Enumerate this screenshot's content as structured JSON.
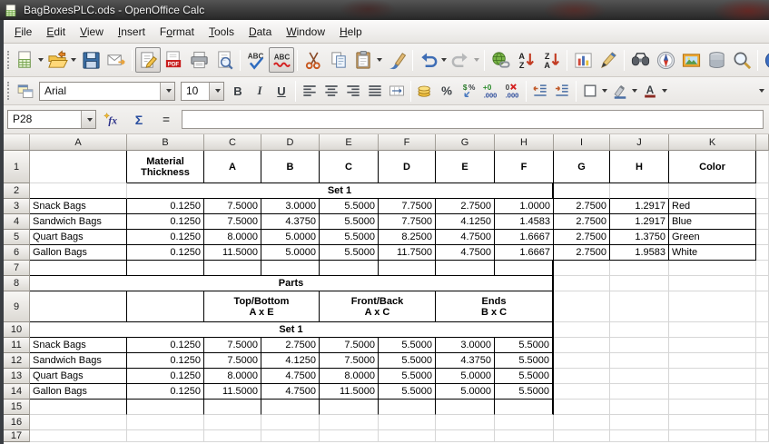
{
  "window": {
    "title": "BagBoxesPLC.ods - OpenOffice Calc",
    "app_icon": "calc-document-icon"
  },
  "menu_bar": {
    "items": [
      {
        "label": "File",
        "mnemonic_index": 0
      },
      {
        "label": "Edit",
        "mnemonic_index": 0
      },
      {
        "label": "View",
        "mnemonic_index": 0
      },
      {
        "label": "Insert",
        "mnemonic_index": 0
      },
      {
        "label": "Format",
        "mnemonic_index": 1
      },
      {
        "label": "Tools",
        "mnemonic_index": 0
      },
      {
        "label": "Data",
        "mnemonic_index": 0
      },
      {
        "label": "Window",
        "mnemonic_index": 0
      },
      {
        "label": "Help",
        "mnemonic_index": 0
      }
    ]
  },
  "standard_toolbar": {
    "buttons": [
      {
        "name": "new-document",
        "dropdown": true
      },
      {
        "name": "open",
        "dropdown": true
      },
      {
        "name": "save"
      },
      {
        "name": "email"
      },
      {
        "separator": true
      },
      {
        "name": "edit-file",
        "framed": true
      },
      {
        "name": "export-pdf"
      },
      {
        "name": "print"
      },
      {
        "name": "page-preview"
      },
      {
        "separator": true
      },
      {
        "name": "spelling"
      },
      {
        "name": "auto-spellcheck",
        "framed": true
      },
      {
        "separator": true
      },
      {
        "name": "cut"
      },
      {
        "name": "copy"
      },
      {
        "name": "paste",
        "dropdown": true
      },
      {
        "name": "format-paintbrush"
      },
      {
        "separator": true
      },
      {
        "name": "undo",
        "dropdown": true
      },
      {
        "name": "redo",
        "dropdown": true,
        "disabled": true
      },
      {
        "separator": true
      },
      {
        "name": "hyperlink"
      },
      {
        "name": "sort-ascending"
      },
      {
        "name": "sort-descending"
      },
      {
        "separator": true
      },
      {
        "name": "chart"
      },
      {
        "name": "draw-functions"
      },
      {
        "separator": true
      },
      {
        "name": "find-replace"
      },
      {
        "name": "navigator"
      },
      {
        "name": "gallery"
      },
      {
        "name": "data-sources"
      },
      {
        "name": "zoom"
      },
      {
        "separator": true
      },
      {
        "name": "help"
      }
    ]
  },
  "formatting_toolbar": {
    "font_name": "Arial",
    "font_size": "10",
    "buttons": [
      {
        "name": "styles"
      },
      {
        "combo": "font"
      },
      {
        "combo": "size"
      },
      {
        "name": "bold",
        "text": "B"
      },
      {
        "name": "italic",
        "text": "I"
      },
      {
        "name": "underline",
        "text": "U"
      },
      {
        "separator": true
      },
      {
        "name": "align-left"
      },
      {
        "name": "align-center"
      },
      {
        "name": "align-right"
      },
      {
        "name": "justify"
      },
      {
        "name": "merge-cells"
      },
      {
        "separator": true
      },
      {
        "name": "currency-format"
      },
      {
        "name": "percent-format"
      },
      {
        "name": "standard-format"
      },
      {
        "name": "add-decimal"
      },
      {
        "name": "delete-decimal"
      },
      {
        "separator": true
      },
      {
        "name": "decrease-indent"
      },
      {
        "name": "increase-indent"
      },
      {
        "separator": true
      },
      {
        "name": "borders",
        "dropdown": true
      },
      {
        "name": "background-color",
        "dropdown": true
      },
      {
        "name": "font-color",
        "dropdown": true
      }
    ]
  },
  "formula_bar": {
    "cell_reference": "P28",
    "input_value": ""
  },
  "sheet": {
    "column_headers": [
      "A",
      "B",
      "C",
      "D",
      "E",
      "F",
      "G",
      "H",
      "I",
      "J",
      "K"
    ],
    "row_count": 17,
    "rows": [
      {
        "n": 1,
        "cells": [
          {
            "col": "A",
            "text": "",
            "b": "r"
          },
          {
            "col": "B",
            "text": "Material\nThickness",
            "bold": true,
            "align": "c",
            "b": "rb"
          },
          {
            "col": "C",
            "text": "A",
            "bold": true,
            "align": "c",
            "b": "rb"
          },
          {
            "col": "D",
            "text": "B",
            "bold": true,
            "align": "c",
            "b": "rb"
          },
          {
            "col": "E",
            "text": "C",
            "bold": true,
            "align": "c",
            "b": "rb"
          },
          {
            "col": "F",
            "text": "D",
            "bold": true,
            "align": "c",
            "b": "rb"
          },
          {
            "col": "G",
            "text": "E",
            "bold": true,
            "align": "c",
            "b": "rb"
          },
          {
            "col": "H",
            "text": "F",
            "bold": true,
            "align": "c",
            "b": "rb"
          },
          {
            "col": "I",
            "text": "G",
            "bold": true,
            "align": "c",
            "b": "rb"
          },
          {
            "col": "J",
            "text": "H",
            "bold": true,
            "align": "c",
            "b": "rb"
          },
          {
            "col": "K",
            "text": "Color",
            "bold": true,
            "align": "c",
            "b": "rb"
          }
        ]
      },
      {
        "n": 2,
        "cells": [
          {
            "col": "A",
            "text": "",
            "b": "b"
          },
          {
            "col": "B",
            "span": 7,
            "text": "Set 1",
            "bold": true,
            "align": "c",
            "b": "Rb"
          },
          {
            "col": "I",
            "text": "",
            "b": "b"
          },
          {
            "col": "J",
            "text": "",
            "b": "b"
          },
          {
            "col": "K",
            "text": "",
            "b": "b"
          }
        ]
      },
      {
        "n": 3,
        "cells": [
          {
            "col": "A",
            "text": "Snack Bags",
            "b": "rb"
          },
          {
            "col": "B",
            "text": "0.1250",
            "align": "r",
            "b": "rb"
          },
          {
            "col": "C",
            "text": "7.5000",
            "align": "r",
            "b": "rb"
          },
          {
            "col": "D",
            "text": "3.0000",
            "align": "r",
            "b": "rb"
          },
          {
            "col": "E",
            "text": "5.5000",
            "align": "r",
            "b": "rb"
          },
          {
            "col": "F",
            "text": "7.7500",
            "align": "r",
            "b": "rb"
          },
          {
            "col": "G",
            "text": "2.7500",
            "align": "r",
            "b": "rb"
          },
          {
            "col": "H",
            "text": "1.0000",
            "align": "r",
            "b": "rb"
          },
          {
            "col": "I",
            "text": "2.7500",
            "align": "r",
            "b": "rb"
          },
          {
            "col": "J",
            "text": "1.2917",
            "align": "r",
            "b": "rb"
          },
          {
            "col": "K",
            "text": "Red",
            "b": "rb"
          }
        ]
      },
      {
        "n": 4,
        "cells": [
          {
            "col": "A",
            "text": "Sandwich Bags",
            "b": "rb"
          },
          {
            "col": "B",
            "text": "0.1250",
            "align": "r",
            "b": "rb"
          },
          {
            "col": "C",
            "text": "7.5000",
            "align": "r",
            "b": "rb"
          },
          {
            "col": "D",
            "text": "4.3750",
            "align": "r",
            "b": "rb"
          },
          {
            "col": "E",
            "text": "5.5000",
            "align": "r",
            "b": "rb"
          },
          {
            "col": "F",
            "text": "7.7500",
            "align": "r",
            "b": "rb"
          },
          {
            "col": "G",
            "text": "4.1250",
            "align": "r",
            "b": "rb"
          },
          {
            "col": "H",
            "text": "1.4583",
            "align": "r",
            "b": "rb"
          },
          {
            "col": "I",
            "text": "2.7500",
            "align": "r",
            "b": "rb"
          },
          {
            "col": "J",
            "text": "1.2917",
            "align": "r",
            "b": "rb"
          },
          {
            "col": "K",
            "text": "Blue",
            "b": "rb"
          }
        ]
      },
      {
        "n": 5,
        "cells": [
          {
            "col": "A",
            "text": "Quart Bags",
            "b": "rb"
          },
          {
            "col": "B",
            "text": "0.1250",
            "align": "r",
            "b": "rb"
          },
          {
            "col": "C",
            "text": "8.0000",
            "align": "r",
            "b": "rb"
          },
          {
            "col": "D",
            "text": "5.0000",
            "align": "r",
            "b": "rb"
          },
          {
            "col": "E",
            "text": "5.5000",
            "align": "r",
            "b": "rb"
          },
          {
            "col": "F",
            "text": "8.2500",
            "align": "r",
            "b": "rb"
          },
          {
            "col": "G",
            "text": "4.7500",
            "align": "r",
            "b": "rb"
          },
          {
            "col": "H",
            "text": "1.6667",
            "align": "r",
            "b": "rb"
          },
          {
            "col": "I",
            "text": "2.7500",
            "align": "r",
            "b": "rb"
          },
          {
            "col": "J",
            "text": "1.3750",
            "align": "r",
            "b": "rb"
          },
          {
            "col": "K",
            "text": "Green",
            "b": "rb"
          }
        ]
      },
      {
        "n": 6,
        "cells": [
          {
            "col": "A",
            "text": "Gallon Bags",
            "b": "rb"
          },
          {
            "col": "B",
            "text": "0.1250",
            "align": "r",
            "b": "rb"
          },
          {
            "col": "C",
            "text": "11.5000",
            "align": "r",
            "b": "rb"
          },
          {
            "col": "D",
            "text": "5.0000",
            "align": "r",
            "b": "rb"
          },
          {
            "col": "E",
            "text": "5.5000",
            "align": "r",
            "b": "rb"
          },
          {
            "col": "F",
            "text": "11.7500",
            "align": "r",
            "b": "rb"
          },
          {
            "col": "G",
            "text": "4.7500",
            "align": "r",
            "b": "rb"
          },
          {
            "col": "H",
            "text": "1.6667",
            "align": "r",
            "b": "rb"
          },
          {
            "col": "I",
            "text": "2.7500",
            "align": "r",
            "b": "rb"
          },
          {
            "col": "J",
            "text": "1.9583",
            "align": "r",
            "b": "rb"
          },
          {
            "col": "K",
            "text": "White",
            "b": "rb"
          }
        ]
      },
      {
        "n": 7,
        "cells": [
          {
            "col": "A",
            "text": "",
            "b": "rb"
          },
          {
            "col": "B",
            "text": "",
            "b": "rb"
          },
          {
            "col": "C",
            "text": "",
            "b": "rb"
          },
          {
            "col": "D",
            "text": "",
            "b": "rb"
          },
          {
            "col": "E",
            "text": "",
            "b": "rb"
          },
          {
            "col": "F",
            "text": "",
            "b": "rb"
          },
          {
            "col": "G",
            "text": "",
            "b": "rb"
          },
          {
            "col": "H",
            "text": "",
            "b": "Rb"
          }
        ]
      },
      {
        "n": 8,
        "cells": [
          {
            "col": "A",
            "span": 8,
            "text": "Parts",
            "bold": true,
            "align": "c",
            "b": "Rb"
          }
        ]
      },
      {
        "n": 9,
        "cells": [
          {
            "col": "A",
            "text": "",
            "b": "rb"
          },
          {
            "col": "B",
            "text": "",
            "b": "rb"
          },
          {
            "col": "C",
            "span": 2,
            "text": "Top/Bottom\nA x E",
            "bold": true,
            "align": "c",
            "b": "rb"
          },
          {
            "col": "E",
            "span": 2,
            "text": "Front/Back\nA x C",
            "bold": true,
            "align": "c",
            "b": "rb"
          },
          {
            "col": "G",
            "span": 2,
            "text": "Ends\nB x C",
            "bold": true,
            "align": "c",
            "b": "Rb"
          }
        ]
      },
      {
        "n": 10,
        "cells": [
          {
            "col": "A",
            "span": 8,
            "text": "Set 1",
            "bold": true,
            "align": "c",
            "b": "Rb"
          }
        ]
      },
      {
        "n": 11,
        "cells": [
          {
            "col": "A",
            "text": "Snack Bags",
            "b": "rb"
          },
          {
            "col": "B",
            "text": "0.1250",
            "align": "r",
            "b": "rb"
          },
          {
            "col": "C",
            "text": "7.5000",
            "align": "r",
            "b": "rb"
          },
          {
            "col": "D",
            "text": "2.7500",
            "align": "r",
            "b": "rb"
          },
          {
            "col": "E",
            "text": "7.5000",
            "align": "r",
            "b": "rb"
          },
          {
            "col": "F",
            "text": "5.5000",
            "align": "r",
            "b": "rb"
          },
          {
            "col": "G",
            "text": "3.0000",
            "align": "r",
            "b": "rb"
          },
          {
            "col": "H",
            "text": "5.5000",
            "align": "r",
            "b": "Rb"
          }
        ]
      },
      {
        "n": 12,
        "cells": [
          {
            "col": "A",
            "text": "Sandwich Bags",
            "b": "rb"
          },
          {
            "col": "B",
            "text": "0.1250",
            "align": "r",
            "b": "rb"
          },
          {
            "col": "C",
            "text": "7.5000",
            "align": "r",
            "b": "rb"
          },
          {
            "col": "D",
            "text": "4.1250",
            "align": "r",
            "b": "rb"
          },
          {
            "col": "E",
            "text": "7.5000",
            "align": "r",
            "b": "rb"
          },
          {
            "col": "F",
            "text": "5.5000",
            "align": "r",
            "b": "rb"
          },
          {
            "col": "G",
            "text": "4.3750",
            "align": "r",
            "b": "rb"
          },
          {
            "col": "H",
            "text": "5.5000",
            "align": "r",
            "b": "Rb"
          }
        ]
      },
      {
        "n": 13,
        "cells": [
          {
            "col": "A",
            "text": "Quart Bags",
            "b": "rb"
          },
          {
            "col": "B",
            "text": "0.1250",
            "align": "r",
            "b": "rb"
          },
          {
            "col": "C",
            "text": "8.0000",
            "align": "r",
            "b": "rb"
          },
          {
            "col": "D",
            "text": "4.7500",
            "align": "r",
            "b": "rb"
          },
          {
            "col": "E",
            "text": "8.0000",
            "align": "r",
            "b": "rb"
          },
          {
            "col": "F",
            "text": "5.5000",
            "align": "r",
            "b": "rb"
          },
          {
            "col": "G",
            "text": "5.0000",
            "align": "r",
            "b": "rb"
          },
          {
            "col": "H",
            "text": "5.5000",
            "align": "r",
            "b": "Rb"
          }
        ]
      },
      {
        "n": 14,
        "cells": [
          {
            "col": "A",
            "text": "Gallon Bags",
            "b": "rb"
          },
          {
            "col": "B",
            "text": "0.1250",
            "align": "r",
            "b": "rb"
          },
          {
            "col": "C",
            "text": "11.5000",
            "align": "r",
            "b": "rb"
          },
          {
            "col": "D",
            "text": "4.7500",
            "align": "r",
            "b": "rb"
          },
          {
            "col": "E",
            "text": "11.5000",
            "align": "r",
            "b": "rb"
          },
          {
            "col": "F",
            "text": "5.5000",
            "align": "r",
            "b": "rb"
          },
          {
            "col": "G",
            "text": "5.0000",
            "align": "r",
            "b": "rb"
          },
          {
            "col": "H",
            "text": "5.5000",
            "align": "r",
            "b": "Rb"
          }
        ]
      },
      {
        "n": 15,
        "cells": [
          {
            "col": "A",
            "text": "",
            "b": "r"
          },
          {
            "col": "B",
            "text": "",
            "b": "r"
          },
          {
            "col": "C",
            "text": "",
            "b": "r"
          },
          {
            "col": "D",
            "text": "",
            "b": "r"
          },
          {
            "col": "E",
            "text": "",
            "b": "r"
          },
          {
            "col": "F",
            "text": "",
            "b": "r"
          },
          {
            "col": "G",
            "text": "",
            "b": "r"
          },
          {
            "col": "H",
            "text": "",
            "b": "R"
          }
        ]
      },
      {
        "n": 16,
        "cells": []
      },
      {
        "n": 17,
        "cells": []
      }
    ]
  }
}
